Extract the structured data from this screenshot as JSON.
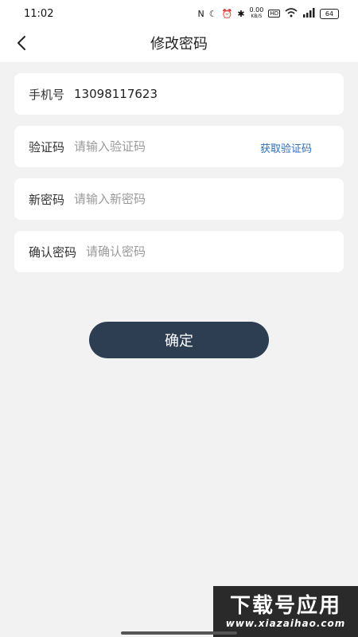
{
  "status_bar": {
    "time": "11:02",
    "net_speed": "0.00",
    "net_speed_unit": "KB/S",
    "hd_badge": "HD",
    "battery": "64",
    "icons": [
      "nfc-icon",
      "moon-icon",
      "alarm-icon",
      "bluetooth-icon",
      "wifi-icon",
      "signal-icon"
    ]
  },
  "header": {
    "title": "修改密码",
    "back_icon": "chevron-left-icon"
  },
  "form": {
    "phone": {
      "label": "手机号",
      "value": "13098117623"
    },
    "code": {
      "label": "验证码",
      "placeholder": "请输入验证码",
      "action": "获取验证码"
    },
    "new_password": {
      "label": "新密码",
      "placeholder": "请输入新密码"
    },
    "confirm_password": {
      "label": "确认密码",
      "placeholder": "请确认密码"
    }
  },
  "confirm_button": {
    "label": "确定"
  },
  "watermark": {
    "text": "下载号应用",
    "url": "www.xiazaihao.com"
  },
  "colors": {
    "background": "#f2f2f2",
    "card": "#ffffff",
    "button": "#2e3e52",
    "link": "#2f6fb6"
  }
}
